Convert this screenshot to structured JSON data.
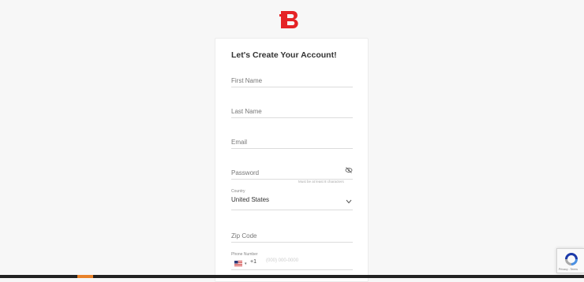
{
  "brand": {
    "logo_icon": "bitcoin-b-logo-icon",
    "accent": "#e52326"
  },
  "form": {
    "title": "Let's Create Your Account!",
    "first_name_placeholder": "First Name",
    "last_name_placeholder": "Last Name",
    "email_placeholder": "Email",
    "password_placeholder": "Password",
    "password_icon": "eye-slash-icon",
    "password_hint": "Must be at least 8 characters",
    "country_label": "Country",
    "country_value": "United States",
    "zip_placeholder": "Zip Code",
    "phone_label": "Phone Number",
    "phone_flag_icon": "us-flag-icon",
    "phone_dial_code": "+1",
    "phone_placeholder": "(000) 000-0000"
  },
  "recaptcha": {
    "icon": "recaptcha-icon",
    "text": "Privacy - Terms"
  },
  "colors": {
    "background": "#f7f7f7",
    "card": "#ffffff",
    "bottom_accent": "#e8822a"
  }
}
